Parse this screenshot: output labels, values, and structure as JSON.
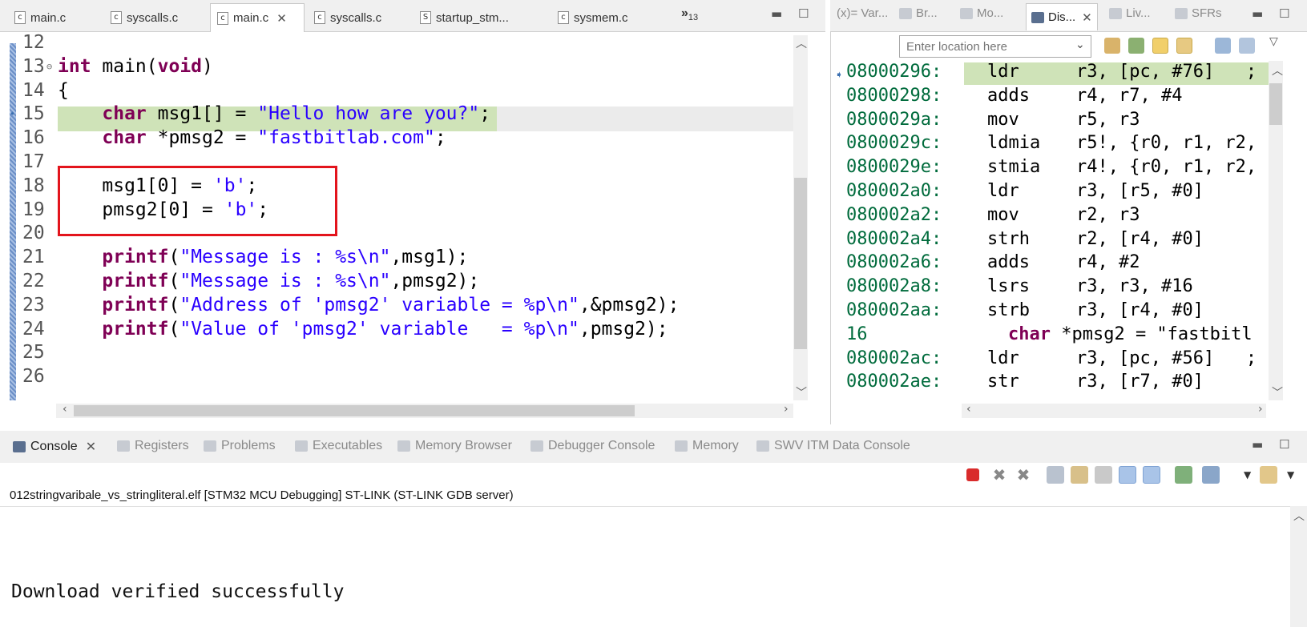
{
  "editor": {
    "tabs": [
      {
        "icon": "c",
        "label": "main.c",
        "active": false,
        "closable": false
      },
      {
        "icon": "c",
        "label": "syscalls.c",
        "active": false,
        "closable": false
      },
      {
        "icon": "c",
        "label": "main.c",
        "active": true,
        "closable": true
      },
      {
        "icon": "c",
        "label": "syscalls.c",
        "active": false,
        "closable": false
      },
      {
        "icon": "S",
        "label": "startup_stm...",
        "active": false,
        "closable": false
      },
      {
        "icon": "c",
        "label": "sysmem.c",
        "active": false,
        "closable": false
      }
    ],
    "overflow_label": "»",
    "overflow_count": "13",
    "lines": [
      {
        "num": "12",
        "text": ""
      },
      {
        "num": "13",
        "text": "int main(void)"
      },
      {
        "num": "14",
        "text": "{"
      },
      {
        "num": "15",
        "text": "    char msg1[] = \"Hello how are you?\";"
      },
      {
        "num": "16",
        "text": "    char *pmsg2 = \"fastbitlab.com\";"
      },
      {
        "num": "17",
        "text": ""
      },
      {
        "num": "18",
        "text": "    msg1[0] = 'b';"
      },
      {
        "num": "19",
        "text": "    pmsg2[0] = 'b';"
      },
      {
        "num": "20",
        "text": ""
      },
      {
        "num": "21",
        "text": "    printf(\"Message is : %s\\n\",msg1);"
      },
      {
        "num": "22",
        "text": "    printf(\"Message is : %s\\n\",pmsg2);"
      },
      {
        "num": "23",
        "text": "    printf(\"Address of 'pmsg2' variable = %p\\n\",&pmsg2);"
      },
      {
        "num": "24",
        "text": "    printf(\"Value of 'pmsg2' variable   = %p\\n\",pmsg2);"
      },
      {
        "num": "25",
        "text": ""
      },
      {
        "num": "26",
        "text": ""
      }
    ],
    "current_line": "15"
  },
  "disassembly": {
    "tabs": [
      {
        "label": "(x)= Var...",
        "active": false
      },
      {
        "label": "Br...",
        "active": false
      },
      {
        "label": "Mo...",
        "active": false
      },
      {
        "label": "Dis...",
        "active": true
      },
      {
        "label": "Liv...",
        "active": false
      },
      {
        "label": "SFRs",
        "active": false
      }
    ],
    "location_placeholder": "Enter location here",
    "rows": [
      {
        "addr": "08000296:",
        "mnemonic": "ldr",
        "operands": "r3, [pc, #76]   ;"
      },
      {
        "addr": "08000298:",
        "mnemonic": "adds",
        "operands": "r4, r7, #4"
      },
      {
        "addr": "0800029a:",
        "mnemonic": "mov",
        "operands": "r5, r3"
      },
      {
        "addr": "0800029c:",
        "mnemonic": "ldmia",
        "operands": "r5!, {r0, r1, r2,"
      },
      {
        "addr": "0800029e:",
        "mnemonic": "stmia",
        "operands": "r4!, {r0, r1, r2,"
      },
      {
        "addr": "080002a0:",
        "mnemonic": "ldr",
        "operands": "r3, [r5, #0]"
      },
      {
        "addr": "080002a2:",
        "mnemonic": "mov",
        "operands": "r2, r3"
      },
      {
        "addr": "080002a4:",
        "mnemonic": "strh",
        "operands": "r2, [r4, #0]"
      },
      {
        "addr": "080002a6:",
        "mnemonic": "adds",
        "operands": "r4, #2"
      },
      {
        "addr": "080002a8:",
        "mnemonic": "lsrs",
        "operands": "r3, r3, #16"
      },
      {
        "addr": "080002aa:",
        "mnemonic": "strb",
        "operands": "r3, [r4, #0]"
      },
      {
        "source_line": "16",
        "source_text": "char *pmsg2 = \"fastbitl"
      },
      {
        "addr": "080002ac:",
        "mnemonic": "ldr",
        "operands": "r3, [pc, #56]   ;"
      },
      {
        "addr": "080002ae:",
        "mnemonic": "str",
        "operands": "r3, [r7, #0]"
      }
    ]
  },
  "console": {
    "tabs": [
      {
        "label": "Console",
        "active": true
      },
      {
        "label": "Registers",
        "active": false
      },
      {
        "label": "Problems",
        "active": false
      },
      {
        "label": "Executables",
        "active": false
      },
      {
        "label": "Memory Browser",
        "active": false
      },
      {
        "label": "Debugger Console",
        "active": false
      },
      {
        "label": "Memory",
        "active": false
      },
      {
        "label": "SWV ITM Data Console",
        "active": false
      }
    ],
    "session_title": "012stringvaribale_vs_stringliteral.elf [STM32 MCU Debugging] ST-LINK (ST-LINK GDB server)",
    "output": "Download verified successfully"
  },
  "colors": {
    "keyword": "#7f0055",
    "string": "#2a00ff",
    "address": "#006b3c",
    "current_line_highlight": "#cfe3b8",
    "red_box": "#e3141c"
  }
}
